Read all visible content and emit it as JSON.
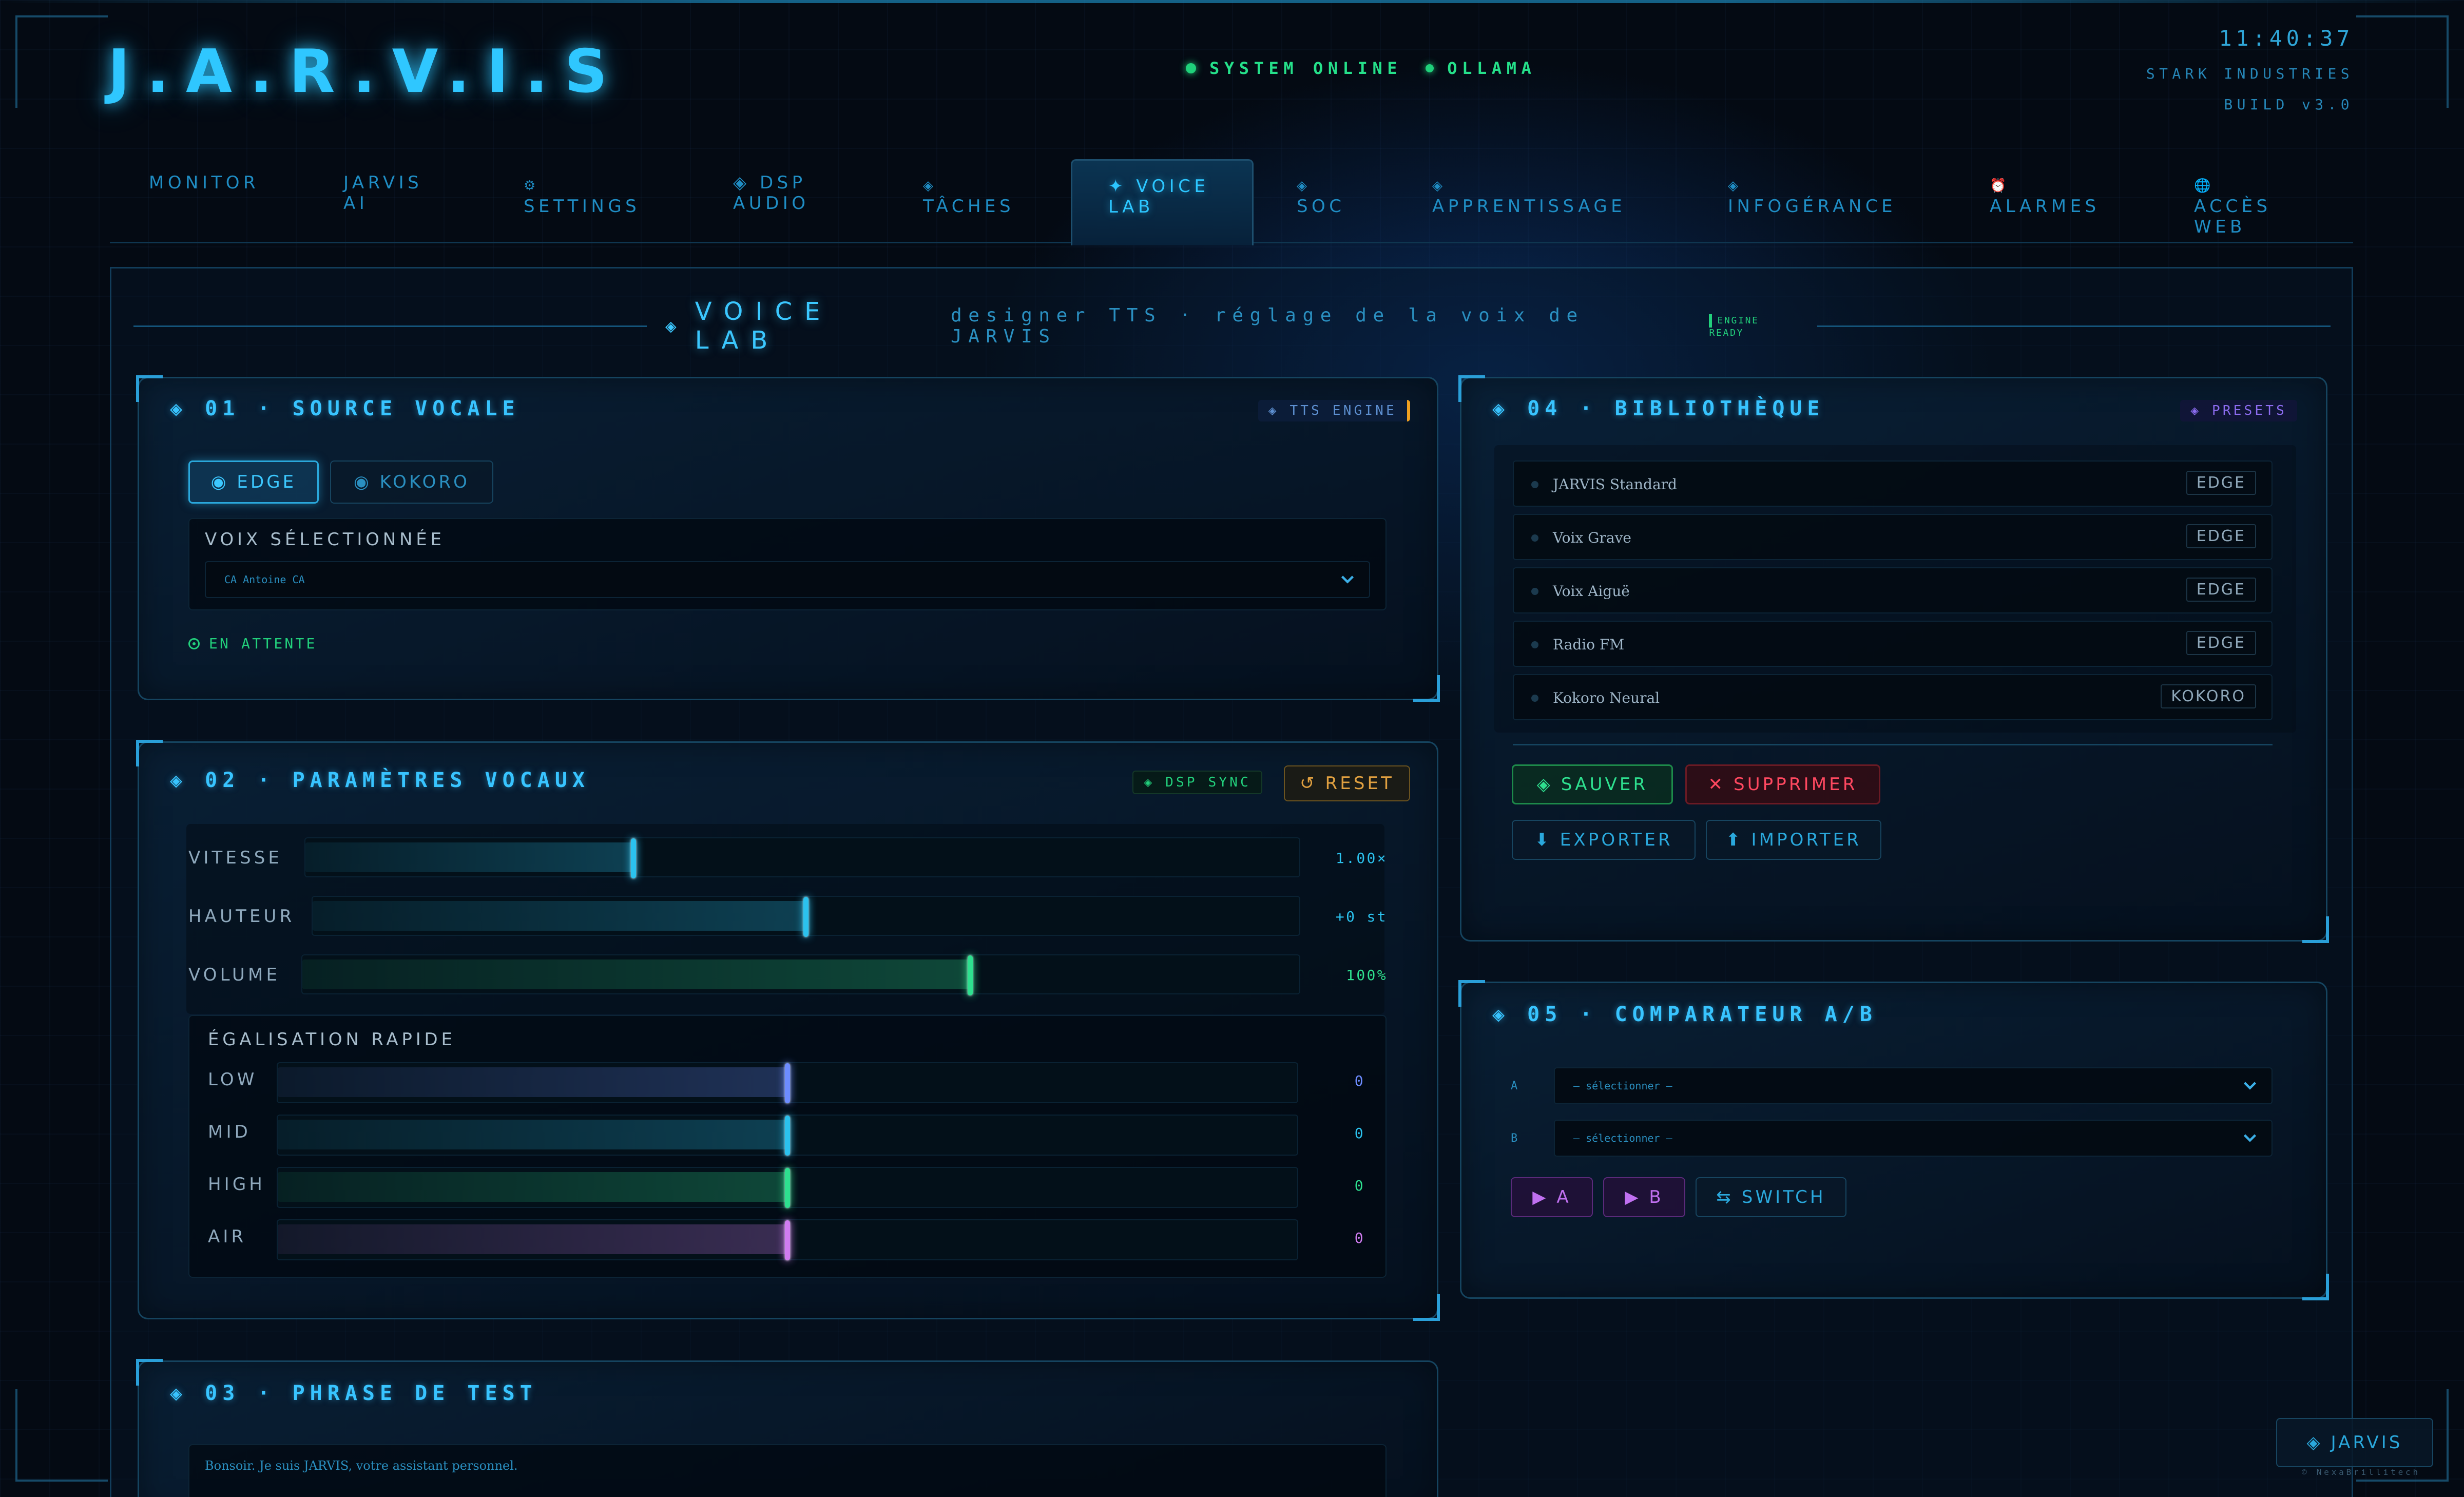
{
  "header": {
    "brand": "J.A.R.V.I.S",
    "status_system": "SYSTEM ONLINE",
    "status_model": "OLLAMA",
    "clock": "11:40:37",
    "company": "STARK INDUSTRIES",
    "build": "BUILD v3.0"
  },
  "nav": {
    "tabs": [
      {
        "icon": "",
        "label": "MONITOR"
      },
      {
        "icon": "",
        "label": "JARVIS AI"
      },
      {
        "icon": "⚙",
        "label": "SETTINGS"
      },
      {
        "icon": "◈",
        "label": "DSP AUDIO"
      },
      {
        "icon": "◈",
        "label": "TÂCHES"
      },
      {
        "icon": "✦",
        "label": "VOICE LAB"
      },
      {
        "icon": "◈",
        "label": "SOC"
      },
      {
        "icon": "◈",
        "label": "APPRENTISSAGE"
      },
      {
        "icon": "◈",
        "label": "INFOGÉRANCE"
      },
      {
        "icon": "⏰",
        "label": "ALARMES"
      },
      {
        "icon": "🌐",
        "label": "ACCÈS WEB"
      }
    ],
    "active": "VOICE LAB"
  },
  "page": {
    "title": "VOICE LAB",
    "subtitle": "designer TTS · réglage de la voix de JARVIS",
    "engine_status": "ENGINE READY"
  },
  "source": {
    "title": "01 · SOURCE VOCALE",
    "badge": "◈ TTS ENGINE",
    "engines": [
      "◉ EDGE",
      "◉ KOKORO"
    ],
    "selected_engine": "EDGE",
    "voice_label": "VOIX SÉLECTIONNÉE",
    "voice_value": "CA Antoine CA",
    "state": "EN ATTENTE"
  },
  "params": {
    "title": "02 · PARAMÈTRES VOCAUX",
    "sync_badge": "◈ DSP SYNC",
    "reset_label": "↺ RESET",
    "sliders": [
      {
        "label": "VITESSE",
        "value": "1.00×",
        "level": 0.33,
        "color": "#2bc2ee"
      },
      {
        "label": "HAUTEUR",
        "value": "+0 st",
        "level": 0.5,
        "color": "#2bc2ee"
      },
      {
        "label": "VOLUME",
        "value": "100%",
        "level": 0.67,
        "color": "#2ee08f"
      }
    ],
    "eq_title": "ÉGALISATION RAPIDE",
    "eq": [
      {
        "label": "LOW",
        "value": "0",
        "level": 0.5,
        "color": "#6d8cff"
      },
      {
        "label": "MID",
        "value": "0",
        "level": 0.5,
        "color": "#2bc2ee"
      },
      {
        "label": "HIGH",
        "value": "0",
        "level": 0.5,
        "color": "#2ee08f"
      },
      {
        "label": "AIR",
        "value": "0",
        "level": 0.5,
        "color": "#d07cf0"
      }
    ]
  },
  "test_phrase": {
    "title": "03 · PHRASE DE TEST",
    "text": "Bonsoir. Je suis JARVIS, votre assistant personnel."
  },
  "library": {
    "title": "04 · BIBLIOTHÈQUE",
    "badge": "◈ PRESETS",
    "items": [
      {
        "name": "JARVIS Standard",
        "engine": "EDGE"
      },
      {
        "name": "Voix Grave",
        "engine": "EDGE"
      },
      {
        "name": "Voix Aiguë",
        "engine": "EDGE"
      },
      {
        "name": "Radio FM",
        "engine": "EDGE"
      },
      {
        "name": "Kokoro Neural",
        "engine": "KOKORO"
      }
    ],
    "save_label": "◈ SAUVER",
    "delete_label": "✕ SUPPRIMER",
    "export_label": "⬇ EXPORTER",
    "import_label": "⬆ IMPORTER"
  },
  "compare": {
    "title": "05 · COMPARATEUR A/B",
    "label_a": "A",
    "label_b": "B",
    "placeholder_a": "— sélectionner —",
    "placeholder_b": "— sélectionner —",
    "play_a": "▶ A",
    "play_b": "▶ B",
    "switch_label": "⇆ SWITCH"
  },
  "footer": {
    "badge": "◈ JARVIS",
    "credit": "© NexaBrillitech"
  }
}
